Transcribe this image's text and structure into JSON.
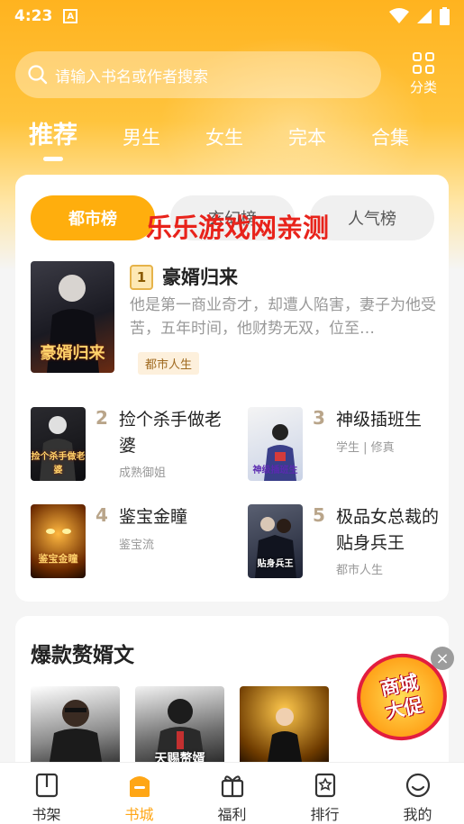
{
  "status": {
    "time": "4:23",
    "app_icon": "A"
  },
  "search": {
    "placeholder": "请输入书名或作者搜索"
  },
  "category": {
    "label": "分类"
  },
  "tabs": [
    {
      "label": "推荐",
      "active": true
    },
    {
      "label": "男生"
    },
    {
      "label": "女生"
    },
    {
      "label": "完本"
    },
    {
      "label": "合集"
    }
  ],
  "rank_tabs": [
    {
      "label": "都市榜",
      "active": true
    },
    {
      "label": "玄幻榜"
    },
    {
      "label": "人气榜"
    }
  ],
  "top_book": {
    "rank": "1",
    "title": "豪婿归来",
    "desc": "他是第一商业奇才，却遭人陷害，妻子为他受苦，五年时间，他财势无双，位至…",
    "tag": "都市人生",
    "cover_text": "豪婿归来"
  },
  "books": [
    {
      "rank": "2",
      "title": "捡个杀手做老婆",
      "sub": "成熟御姐",
      "cover_text": "捡个杀手做老婆"
    },
    {
      "rank": "3",
      "title": "神级插班生",
      "sub": "学生 | 修真",
      "cover_text": "神级插班生"
    },
    {
      "rank": "4",
      "title": "鉴宝金瞳",
      "sub": "鉴宝流",
      "cover_text": "鉴宝金瞳"
    },
    {
      "rank": "5",
      "title": "极品女总裁的贴身兵王",
      "sub": "都市人生",
      "cover_text": "贴身兵王"
    }
  ],
  "watermark": "乐乐游戏网亲测",
  "section2": {
    "heading": "爆款赘婿文",
    "cover_text": "天赐赘婿"
  },
  "promo": {
    "line1": "商城",
    "line2": "大促",
    "close": "×"
  },
  "nav": [
    {
      "label": "书架",
      "icon": "bookshelf-icon"
    },
    {
      "label": "书城",
      "icon": "bookstore-icon",
      "active": true
    },
    {
      "label": "福利",
      "icon": "gift-icon"
    },
    {
      "label": "排行",
      "icon": "ranking-icon"
    },
    {
      "label": "我的",
      "icon": "profile-icon"
    }
  ],
  "colors": {
    "accent": "#ffae0d",
    "watermark": "#e8231b"
  }
}
